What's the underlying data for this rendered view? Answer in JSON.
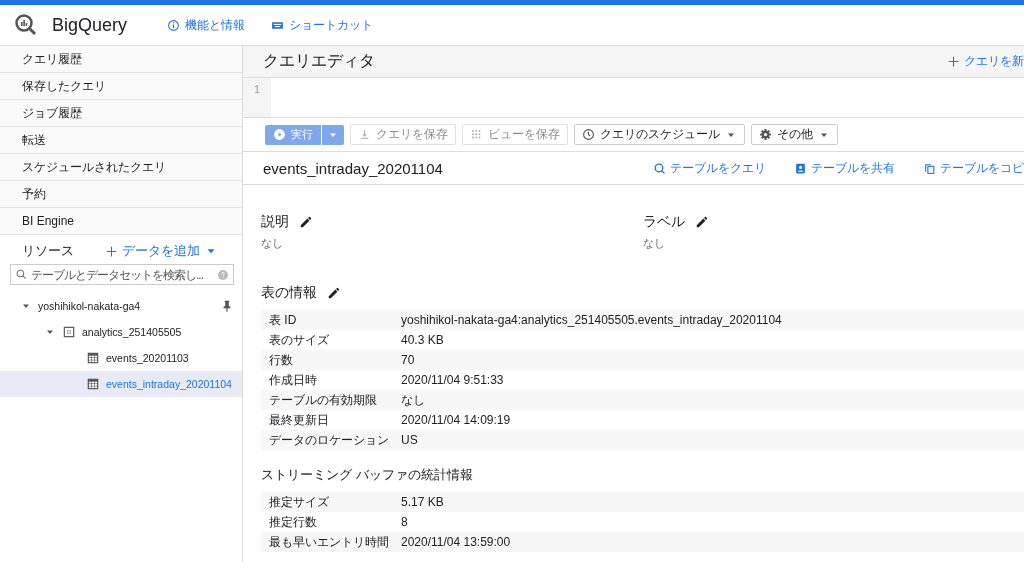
{
  "header": {
    "product": "BigQuery",
    "links": [
      {
        "kind": "info",
        "label": "機能と情報"
      },
      {
        "kind": "keyboard",
        "label": "ショートカット"
      }
    ]
  },
  "sidebar": {
    "items": [
      {
        "label": "クエリ履歴"
      },
      {
        "label": "保存したクエリ"
      },
      {
        "label": "ジョブ履歴"
      },
      {
        "label": "転送"
      },
      {
        "label": "スケジュールされたクエリ"
      },
      {
        "label": "予約"
      },
      {
        "label": "BI Engine"
      }
    ],
    "resources": {
      "title": "リソース",
      "add_data": "データを追加",
      "search": {
        "placeholder": "テーブルとデータセットを検索し..."
      },
      "tree": [
        {
          "kind": "project",
          "label": "yoshihikol-nakata-ga4",
          "expanded": true,
          "selected": false,
          "children": [
            {
              "kind": "dataset",
              "label": "analytics_251405505",
              "expanded": true,
              "selected": false,
              "children": [
                {
                  "kind": "table",
                  "label": "events_20201103",
                  "selected": false
                },
                {
                  "kind": "table",
                  "label": "events_intraday_20201104",
                  "selected": true
                }
              ]
            }
          ]
        }
      ]
    }
  },
  "editor": {
    "title": "クエリエディタ",
    "new_query": "クエリを新",
    "line_numbers": [
      "1"
    ]
  },
  "toolbar": [
    {
      "kind": "run",
      "label": "実行",
      "disabled": true
    },
    {
      "kind": "download",
      "label": "クエリを保存",
      "disabled": true
    },
    {
      "kind": "grid",
      "label": "ビューを保存",
      "disabled": true
    },
    {
      "kind": "clock",
      "label": "クエリのスケジュール",
      "disabled": false
    },
    {
      "kind": "gear",
      "label": "その他",
      "disabled": false
    }
  ],
  "table": {
    "name": "events_intraday_20201104",
    "actions": [
      {
        "kind": "query",
        "label": "テーブルをクエリ"
      },
      {
        "kind": "share",
        "label": "テーブルを共有"
      },
      {
        "kind": "copy",
        "label": "テーブルをコピ"
      }
    ],
    "description": {
      "title": "説明",
      "value": "なし"
    },
    "labels": {
      "title": "ラベル",
      "value": "なし"
    },
    "sections": [
      {
        "title": "表の情報",
        "editable": true,
        "rows": [
          {
            "key": "表 ID",
            "value": "yoshihikol-nakata-ga4:analytics_251405505.events_intraday_20201104"
          },
          {
            "key": "表のサイズ",
            "value": "40.3 KB"
          },
          {
            "key": "行数",
            "value": "70"
          },
          {
            "key": "作成日時",
            "value": "2020/11/04 9:51:33"
          },
          {
            "key": "テーブルの有効期限",
            "value": "なし"
          },
          {
            "key": "最終更新日",
            "value": "2020/11/04 14:09:19"
          },
          {
            "key": "データのロケーション",
            "value": "US"
          }
        ]
      },
      {
        "title": "ストリーミング バッファの統計情報",
        "editable": false,
        "rows": [
          {
            "key": "推定サイズ",
            "value": "5.17 KB"
          },
          {
            "key": "推定行数",
            "value": "8"
          },
          {
            "key": "最も早いエントリ時間",
            "value": "2020/11/04 13:59:00"
          }
        ]
      }
    ]
  }
}
